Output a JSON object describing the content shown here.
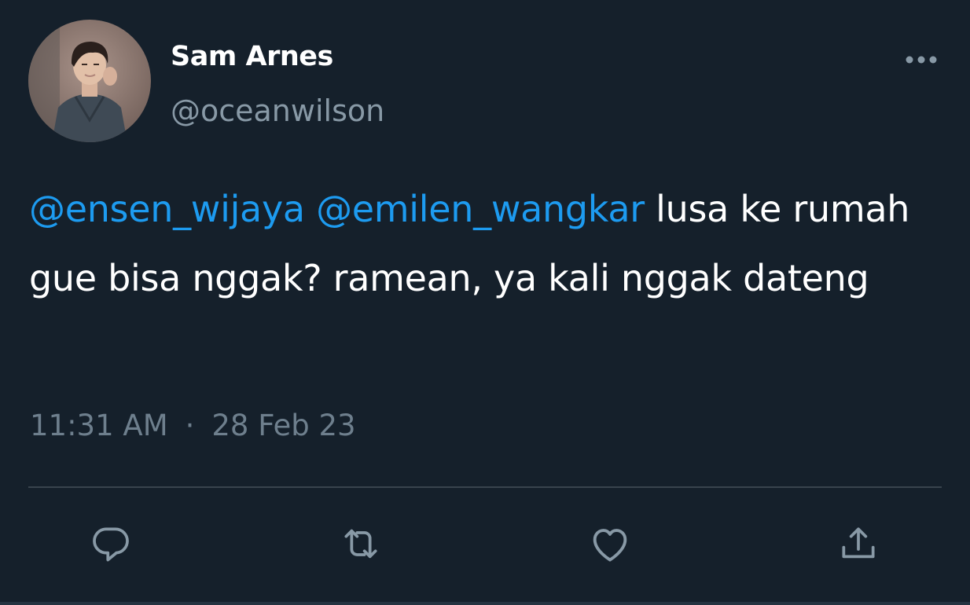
{
  "tweet": {
    "author_name": "Sam Arnes",
    "author_handle": "@oceanwilson",
    "mention_1": "@ensen_wijaya",
    "mention_2": "@emilen_wangkar",
    "text_after_mentions": " lusa ke rumah gue bisa nggak? ramean, ya kali nggak dateng",
    "time": "11:31 AM",
    "separator": "·",
    "date": "28 Feb 23"
  },
  "actions": [
    {
      "icon": "reply-icon"
    },
    {
      "icon": "retweet-icon"
    },
    {
      "icon": "like-icon"
    },
    {
      "icon": "share-icon"
    }
  ],
  "colors": {
    "background": "#15202b",
    "text": "#ffffff",
    "secondary": "#8899a6",
    "mention": "#1d9bf0",
    "divider": "#38444d"
  }
}
